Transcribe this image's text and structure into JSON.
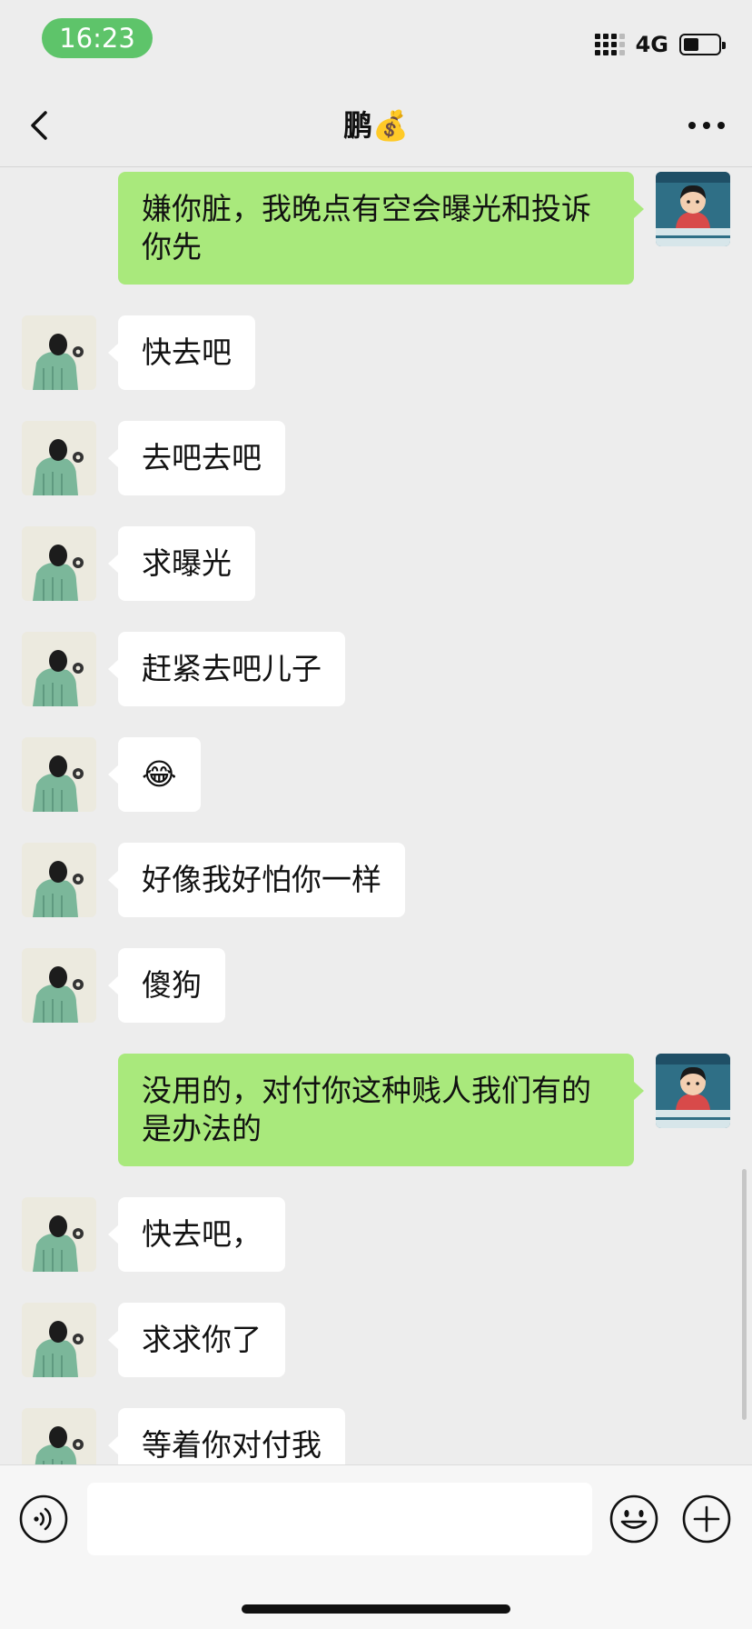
{
  "status_bar": {
    "time": "16:23",
    "network": "4G"
  },
  "nav": {
    "title": "鹏💰"
  },
  "messages": [
    {
      "side": "right",
      "text": "嫌你脏，我晚点有空会曝光和投诉你先"
    },
    {
      "side": "left",
      "text": "快去吧"
    },
    {
      "side": "left",
      "text": "去吧去吧"
    },
    {
      "side": "left",
      "text": "求曝光"
    },
    {
      "side": "left",
      "text": "赶紧去吧儿子"
    },
    {
      "side": "left",
      "text": "😂"
    },
    {
      "side": "left",
      "text": "好像我好怕你一样"
    },
    {
      "side": "left",
      "text": "傻狗"
    },
    {
      "side": "right",
      "text": "没用的，对付你这种贱人我们有的是办法的"
    },
    {
      "side": "left",
      "text": "快去吧，"
    },
    {
      "side": "left",
      "text": "求求你了"
    },
    {
      "side": "left",
      "text": "等着你对付我"
    }
  ],
  "input": {
    "value": "",
    "placeholder": ""
  },
  "colors": {
    "background": "#ededed",
    "outgoing_bubble": "#a9e97c",
    "incoming_bubble": "#ffffff",
    "time_pill": "#5ec46a"
  },
  "icons": {
    "back": "chevron-left-icon",
    "more": "more-dots-icon",
    "voice": "voice-icon",
    "emoji": "emoji-icon",
    "plus": "plus-icon"
  }
}
